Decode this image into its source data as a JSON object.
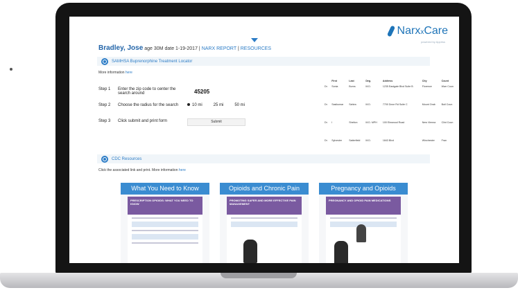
{
  "logo": {
    "text_main": "Narx",
    "text_sub": "x",
    "text_end": "Care",
    "tagline": "powered by Appriss"
  },
  "patient": {
    "name": "Bradley, Jose",
    "age_label": "age",
    "age": "30M",
    "date_label": "date",
    "date": "1-19-2017",
    "nav": [
      "NARX REPORT",
      "RESOURCES"
    ],
    "sep": "|"
  },
  "samhsa": {
    "title": "SAMHSA Buprenorphine Treatment Locator",
    "more_info": "More information",
    "more_link": "here",
    "steps": [
      {
        "num": "Step 1",
        "text": "Enter the zip code to center the search around"
      },
      {
        "num": "Step 2",
        "text": "Choose the radius for the search"
      },
      {
        "num": "Step 3",
        "text": "Click submit and print form"
      }
    ],
    "zip": "45205",
    "radius_options": [
      "10 mi",
      "25 mi",
      "50 mi"
    ],
    "submit_label": "Submit"
  },
  "table": {
    "headers": [
      "",
      "First",
      "Last",
      "Deg.",
      "Address",
      "City",
      "Count"
    ],
    "rows": [
      [
        "Dr.",
        "Sonia",
        "Burns",
        "M.D.",
        "1235 Eastgate Blvd Suite B",
        "Florence",
        "Warr Coun"
      ],
      [
        "Dr.",
        "Sasikumar",
        "Sahira",
        "M.D.",
        "7700 Dove Rd Suite C",
        "Mount Orab",
        "Butl Coun"
      ],
      [
        "Dr.",
        "I",
        "Shelton",
        "M.D. MPH",
        "100 Elmwood Road",
        "New Vienna",
        "Clint Coun"
      ],
      [
        "Dr.",
        "Sylvester",
        "Satterfield",
        "M.D.",
        "1843 Blvd",
        "Winchester",
        "Fran"
      ]
    ]
  },
  "cdc": {
    "title": "CDC Resources",
    "instruction": "Click the associated link and print. More information",
    "link": "here",
    "cards": [
      {
        "title": "What You Need to Know",
        "poster_text": "PRESCRIPTION OPIOIDS: WHAT YOU NEED TO KNOW"
      },
      {
        "title": "Opioids and Chronic Pain",
        "poster_text": "PROMOTING SAFER AND MORE EFFECTIVE PAIN MANAGEMENT"
      },
      {
        "title": "Pregnancy and Opioids",
        "poster_text": "PREGNANCY AND OPIOID PAIN MEDICATIONS"
      }
    ]
  },
  "colors": {
    "accent": "#2c7cc6",
    "header_blue": "#3a8cd1",
    "poster_purple": "#7a5aa0"
  }
}
